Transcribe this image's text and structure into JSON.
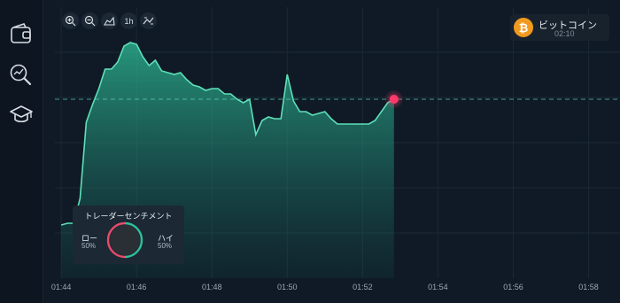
{
  "sidebar": {
    "items": [
      {
        "icon": "wallet-icon"
      },
      {
        "icon": "analytics-search-icon"
      },
      {
        "icon": "education-cap-icon"
      }
    ]
  },
  "toolbar": {
    "tools": [
      {
        "icon": "zoom-in-icon"
      },
      {
        "icon": "zoom-out-icon"
      },
      {
        "icon": "area-chart-icon"
      },
      {
        "label": "1h"
      },
      {
        "icon": "drawing-tools-icon"
      }
    ]
  },
  "asset": {
    "name": "ビットコイン",
    "time": "02:10",
    "icon": "bitcoin-icon",
    "icon_color": "#f29a1f"
  },
  "sentiment": {
    "title": "トレーダーセンチメント",
    "low_label": "ロー",
    "low_pct": "50%",
    "high_label": "ハイ",
    "high_pct": "50%",
    "low_color": "#e84b6a",
    "high_color": "#2fbf98",
    "low_fraction": 0.5
  },
  "colors": {
    "line": "#5fe0b8",
    "current_marker": "#ff3a6b",
    "grid": "#1b2834"
  },
  "chart_data": {
    "type": "area",
    "x_ticks": [
      "01:44",
      "01:46",
      "01:48",
      "01:50",
      "01:52",
      "01:54",
      "01:56",
      "01:58"
    ],
    "xlim": [
      "01:43:50",
      "01:58:50"
    ],
    "x": [
      "01:44:00",
      "01:44:10",
      "01:44:20",
      "01:44:30",
      "01:44:40",
      "01:44:50",
      "01:45:00",
      "01:45:10",
      "01:45:20",
      "01:45:30",
      "01:45:40",
      "01:45:50",
      "01:46:00",
      "01:46:10",
      "01:46:20",
      "01:46:30",
      "01:46:40",
      "01:46:50",
      "01:47:00",
      "01:47:10",
      "01:47:20",
      "01:47:30",
      "01:47:40",
      "01:47:50",
      "01:48:00",
      "01:48:10",
      "01:48:20",
      "01:48:30",
      "01:48:40",
      "01:48:50",
      "01:49:00",
      "01:49:10",
      "01:49:20",
      "01:49:30",
      "01:49:40",
      "01:49:50",
      "01:50:00",
      "01:50:10",
      "01:50:20",
      "01:50:30",
      "01:50:40",
      "01:50:50",
      "01:51:00",
      "01:51:10",
      "01:51:20",
      "01:51:30",
      "01:51:40",
      "01:51:50",
      "01:52:00",
      "01:52:10",
      "01:52:20",
      "01:52:30",
      "01:52:40",
      "01:52:50"
    ],
    "y": [
      0.92,
      0.93,
      0.93,
      1.07,
      1.5,
      1.6,
      1.69,
      1.8,
      1.8,
      1.84,
      1.93,
      1.95,
      1.94,
      1.87,
      1.82,
      1.85,
      1.79,
      1.78,
      1.77,
      1.78,
      1.74,
      1.71,
      1.7,
      1.68,
      1.69,
      1.69,
      1.66,
      1.66,
      1.63,
      1.61,
      1.63,
      1.43,
      1.51,
      1.53,
      1.52,
      1.52,
      1.77,
      1.62,
      1.56,
      1.56,
      1.54,
      1.55,
      1.56,
      1.52,
      1.49,
      1.49,
      1.49,
      1.49,
      1.49,
      1.49,
      1.51,
      1.56,
      1.61,
      1.63
    ],
    "current_value": 1.63,
    "ylim": [
      0.62,
      2.15
    ],
    "grid": true
  }
}
